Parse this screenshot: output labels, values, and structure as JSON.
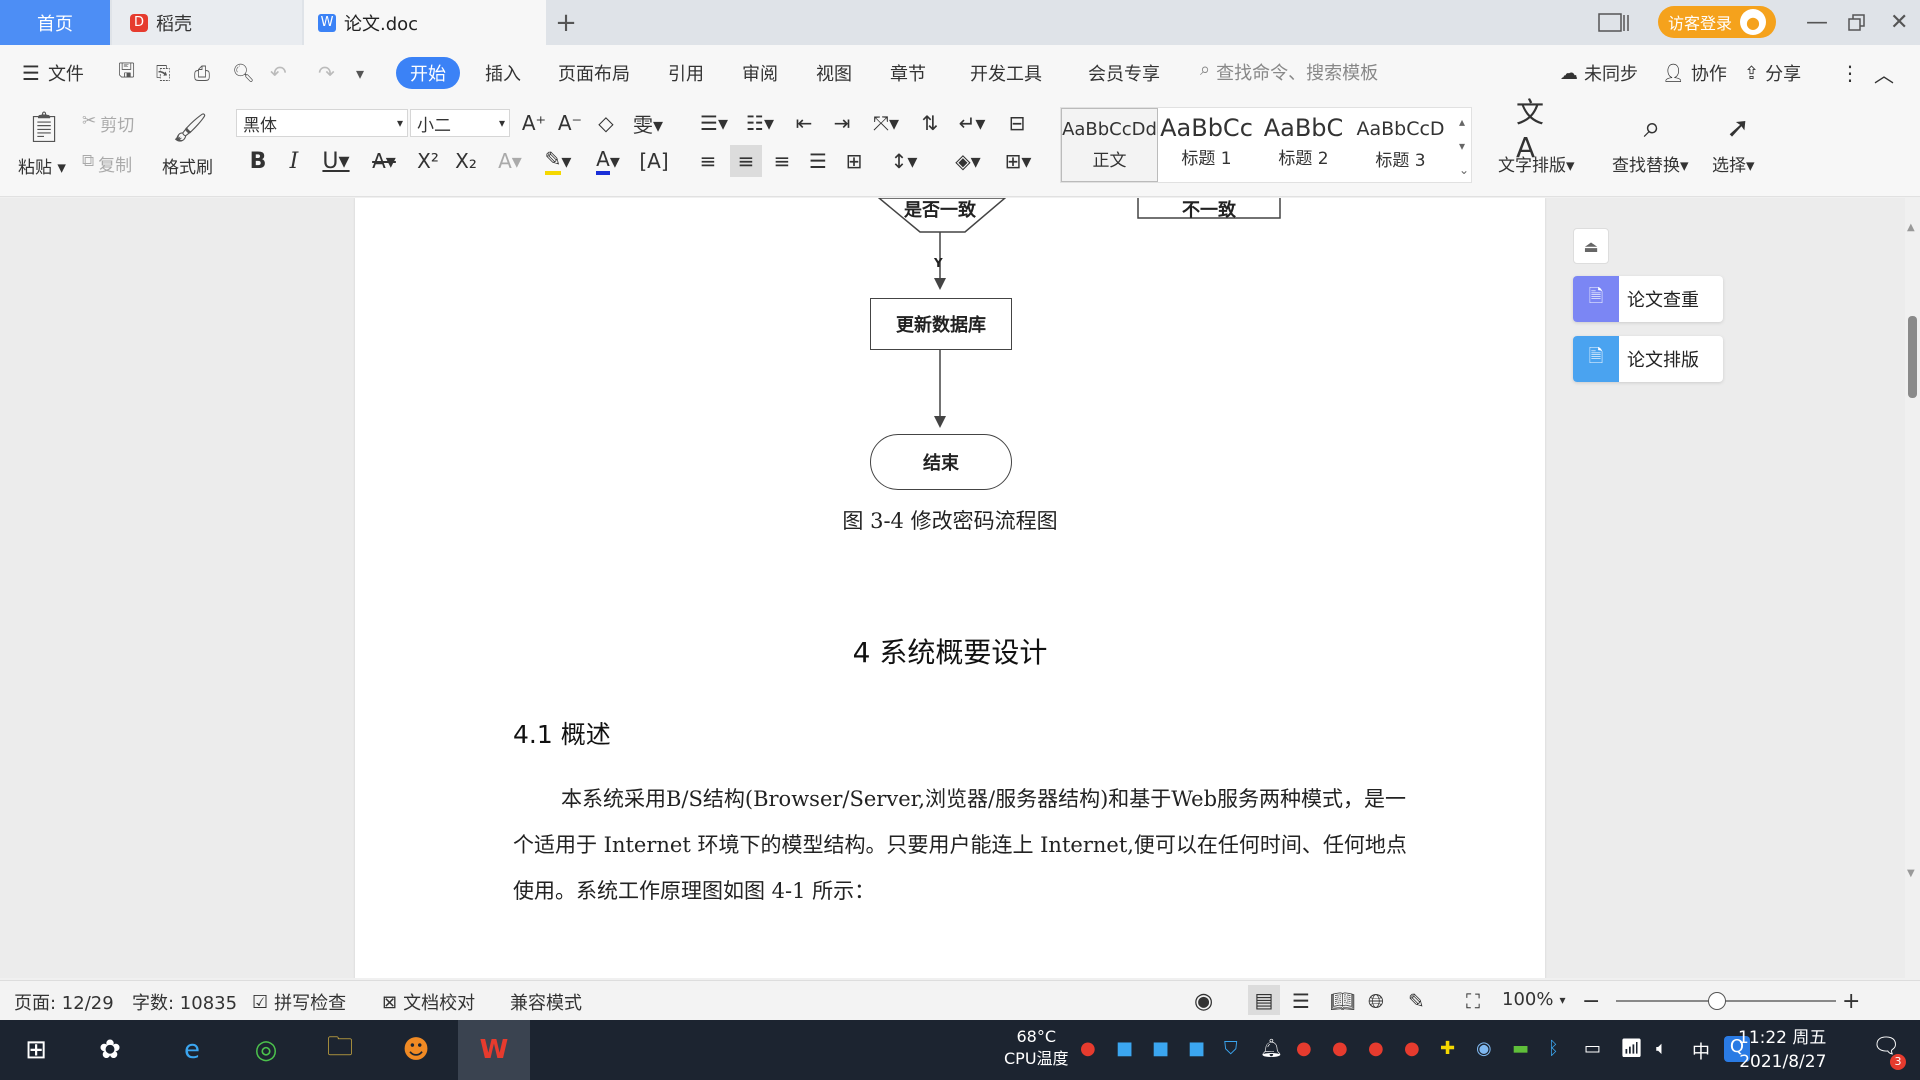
{
  "tabs": {
    "home": "首页",
    "daoke": "稻壳",
    "doc": "论文.doc",
    "add": "+"
  },
  "titlebar": {
    "login": "访客登录"
  },
  "menu": {
    "file": "文件",
    "items": [
      "开始",
      "插入",
      "页面布局",
      "引用",
      "审阅",
      "视图",
      "章节",
      "开发工具",
      "会员专享"
    ],
    "search_placeholder": "查找命令、搜索模板",
    "sync": "未同步",
    "collab": "协作",
    "share": "分享"
  },
  "ribbon": {
    "paste": "粘贴",
    "cut": "剪切",
    "copy": "复制",
    "format_painter": "格式刷",
    "font": "黑体",
    "size": "小二",
    "styles": [
      {
        "sample": "AaBbCcDd",
        "name": "正文"
      },
      {
        "sample": "AaBbCc",
        "name": "标题 1"
      },
      {
        "sample": "AaBbC",
        "name": "标题 2"
      },
      {
        "sample": "AaBbCcD",
        "name": "标题 3"
      }
    ],
    "text_layout": "文字排版",
    "find_replace": "查找替换",
    "select": "选择"
  },
  "document": {
    "flow_decision": "是否一致",
    "flow_yes": "Y",
    "flow_mismatch": "不一致",
    "flow_update": "更新数据库",
    "flow_end": "结束",
    "caption": "图 3-4 修改密码流程图",
    "heading1": "4 系统概要设计",
    "heading2": "4.1 概述",
    "paragraph": "本系统采用B/S结构(Browser/Server,浏览器/服务器结构)和基于Web服务两种模式，是一个适用于 Internet 环境下的模型结构。只要用户能连上 Internet,便可以在任何时间、任何地点使用。系统工作原理图如图 4-1 所示："
  },
  "sidepanel": {
    "check": "论文查重",
    "format": "论文排版"
  },
  "statusbar": {
    "page": "页面: 12/29",
    "words": "字数: 10835",
    "spell": "拼写检查",
    "proof": "文档校对",
    "compat": "兼容模式",
    "zoom": "100%"
  },
  "taskbar": {
    "temp": "68°C",
    "cpu_label": "CPU温度",
    "ime": "中",
    "time": "11:22 周五",
    "date": "2021/8/27",
    "notify_count": "3"
  },
  "colors": {
    "accent": "#3b82f6",
    "home_tab": "#4d8ef5",
    "login": "#f5a21c",
    "wps_red": "#e63b2e"
  }
}
